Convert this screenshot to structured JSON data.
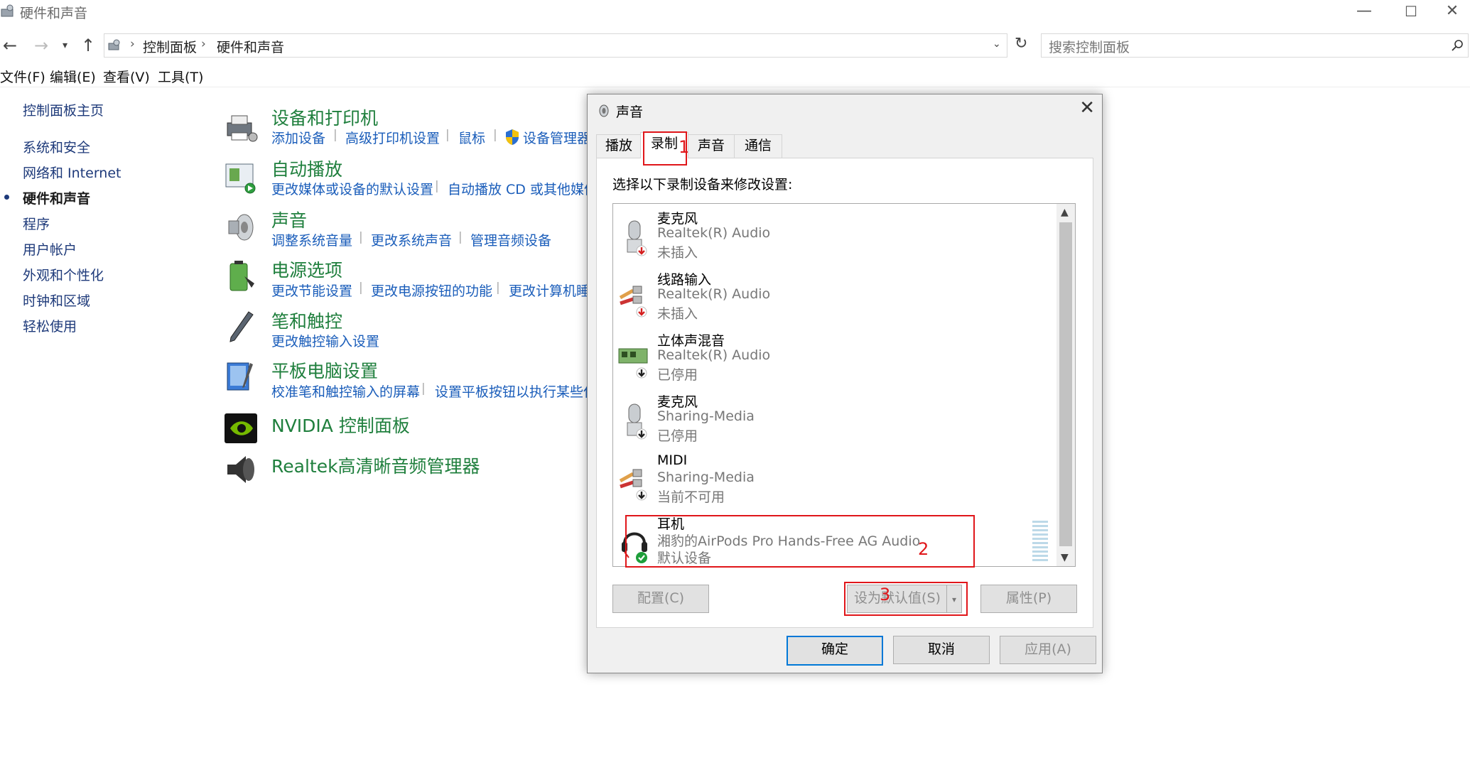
{
  "window": {
    "title": "硬件和声音",
    "minimize": "—",
    "maximize": "☐",
    "close": "✕"
  },
  "address": {
    "crumbs": [
      "控制面板",
      "硬件和声音"
    ],
    "search_placeholder": "搜索控制面板"
  },
  "menu": [
    "文件(F)",
    "编辑(E)",
    "查看(V)",
    "工具(T)"
  ],
  "sidebar": {
    "home": "控制面板主页",
    "items": [
      "系统和安全",
      "网络和 Internet",
      "硬件和声音",
      "程序",
      "用户帐户",
      "外观和个性化",
      "时钟和区域",
      "轻松使用"
    ],
    "active_index": 2
  },
  "categories": [
    {
      "title": "设备和打印机",
      "links": [
        "添加设备",
        "高级打印机设置",
        "鼠标",
        "设备管理器"
      ]
    },
    {
      "title": "自动播放",
      "links": [
        "更改媒体或设备的默认设置",
        "自动播放 CD 或其他媒体"
      ]
    },
    {
      "title": "声音",
      "links": [
        "调整系统音量",
        "更改系统声音",
        "管理音频设备"
      ]
    },
    {
      "title": "电源选项",
      "links": [
        "更改节能设置",
        "更改电源按钮的功能",
        "更改计算机睡眠"
      ]
    },
    {
      "title": "笔和触控",
      "links": [
        "更改触控输入设置"
      ]
    },
    {
      "title": "平板电脑设置",
      "links": [
        "校准笔和触控输入的屏幕",
        "设置平板按钮以执行某些任"
      ]
    },
    {
      "title": "NVIDIA 控制面板",
      "links": []
    },
    {
      "title": "Realtek高清晰音频管理器",
      "links": []
    }
  ],
  "dialog": {
    "title": "声音",
    "close": "✕",
    "tabs": [
      "播放",
      "录制",
      "声音",
      "通信"
    ],
    "active_tab": 1,
    "instruction": "选择以下录制设备来修改设置:",
    "devices": [
      {
        "name": "麦克风",
        "driver": "Realtek(R) Audio",
        "status": "未插入",
        "icon": "microphone-icon",
        "badge": "unplugged"
      },
      {
        "name": "线路输入",
        "driver": "Realtek(R) Audio",
        "status": "未插入",
        "icon": "line-in-cable-icon",
        "badge": "unplugged"
      },
      {
        "name": "立体声混音",
        "driver": "Realtek(R) Audio",
        "status": "已停用",
        "icon": "sound-card-icon",
        "badge": "disabled"
      },
      {
        "name": "麦克风",
        "driver": "Sharing-Media",
        "status": "已停用",
        "icon": "microphone-icon",
        "badge": "disabled"
      },
      {
        "name": "MIDI",
        "driver": "Sharing-Media",
        "status": "当前不可用",
        "icon": "line-in-cable-icon",
        "badge": "disabled"
      },
      {
        "name": "耳机",
        "driver": "湘豹的AirPods Pro Hands-Free AG Audio",
        "status": "默认设备",
        "icon": "headset-icon",
        "badge": "default"
      }
    ],
    "buttons": {
      "configure": "配置(C)",
      "set_default": "设为默认值(S)",
      "properties": "属性(P)",
      "ok": "确定",
      "cancel": "取消",
      "apply": "应用(A)"
    },
    "annotations": [
      "1",
      "2",
      "3"
    ]
  },
  "colors": {
    "link": "#1a5dba",
    "category_title": "#1f7f3d",
    "annotation_red": "#e0161a",
    "primary_border": "#0078d7"
  }
}
